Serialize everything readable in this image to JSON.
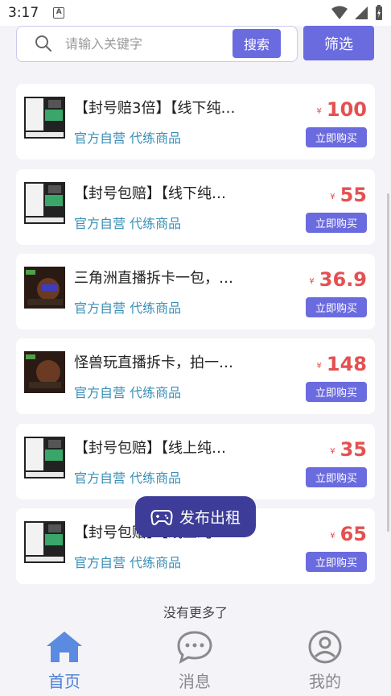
{
  "status_bar": {
    "time": "3:17",
    "a_badge": "A"
  },
  "search": {
    "placeholder": "请输入关键字",
    "button_label": "搜索"
  },
  "filter": {
    "label": "筛选"
  },
  "products": [
    {
      "title": "【封号赔3倍】【线下纯…",
      "tags": "官方自营 代练商品",
      "currency": "¥",
      "price": "100",
      "buy_label": "立即购买"
    },
    {
      "title": "【封号包赔】【线下纯…",
      "tags": "官方自营 代练商品",
      "currency": "¥",
      "price": "55",
      "buy_label": "立即购买"
    },
    {
      "title": "三角洲直播拆卡一包，…",
      "tags": "官方自营 代练商品",
      "currency": "¥",
      "price": "36.9",
      "buy_label": "立即购买"
    },
    {
      "title": "怪兽玩直播拆卡，拍一…",
      "tags": "官方自营 代练商品",
      "currency": "¥",
      "price": "148",
      "buy_label": "立即购买"
    },
    {
      "title": "【封号包赔】【线上纯…",
      "tags": "官方自营 代练商品",
      "currency": "¥",
      "price": "35",
      "buy_label": "立即购买"
    },
    {
      "title": "【封号包赔】【线上纯…",
      "tags": "官方自营 代练商品",
      "currency": "¥",
      "price": "65",
      "buy_label": "立即购买"
    }
  ],
  "publish": {
    "label": "发布出租"
  },
  "no_more": "没有更多了",
  "tabs": [
    {
      "label": "首页",
      "icon": "home-icon",
      "active": true
    },
    {
      "label": "消息",
      "icon": "chat-icon",
      "active": false
    },
    {
      "label": "我的",
      "icon": "user-icon",
      "active": false
    }
  ],
  "colors": {
    "accent": "#6b6be0",
    "price": "#e55050",
    "tag": "#3a8fb7",
    "active_tab": "#4a7fd6",
    "publish_bg": "#3d3c99"
  }
}
